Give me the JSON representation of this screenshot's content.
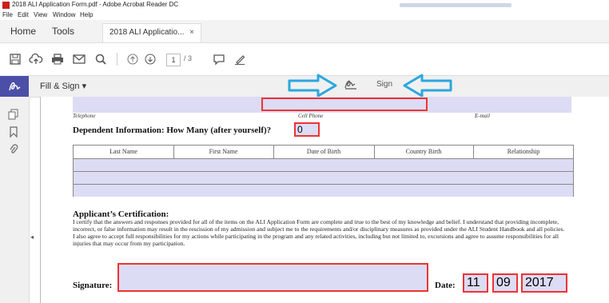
{
  "window": {
    "title": "2018 ALI Application Form.pdf - Adobe Acrobat Reader DC"
  },
  "menu": [
    "File",
    "Edit",
    "View",
    "Window",
    "Help"
  ],
  "tabs": {
    "home": "Home",
    "tools": "Tools",
    "document": "2018 ALI Applicatio...",
    "close": "×"
  },
  "toolbar": {
    "page_current": "1",
    "page_total": "/ 3"
  },
  "fill_sign": {
    "label": "Fill & Sign ▾",
    "sign_label": "Sign"
  },
  "form": {
    "labels": {
      "telephone": "Telephone",
      "cell_phone": "Cell Phone",
      "email": "E-mail"
    },
    "dependent_heading": "Dependent Information: How Many (after yourself)?",
    "dependent_count": "0",
    "table_headers": [
      "Last Name",
      "First Name",
      "Date of Birth",
      "Country Birth",
      "Relationship"
    ],
    "certification_heading": "Applicant’s Certification:",
    "certification_text_1": "I certify that the answers and responses provided for all of the items on the ALI Application Form are complete and true to the best of my knowledge and belief. I understand that providing incomplete, incorrect, or false information may result in the rescission of my admission and subject me to the requirements and/or disciplinary measures as provided under the ALI Student Handbook and all policies.",
    "certification_text_2": "I also agree to accept full responsibilities for my actions while participating in the program and any related activities, including but not limited to, excursions and agree to assume responsibilities for all injuries that may occur from my participation.",
    "signature_label": "Signature:",
    "date_label": "Date:",
    "date_month": "11",
    "date_day": "09",
    "date_year": "2017"
  },
  "colors": {
    "field_fill": "#dcdcf5",
    "field_border": "#e33333",
    "arrow": "#2aa7e0",
    "active_tool": "#4b4fa8"
  }
}
